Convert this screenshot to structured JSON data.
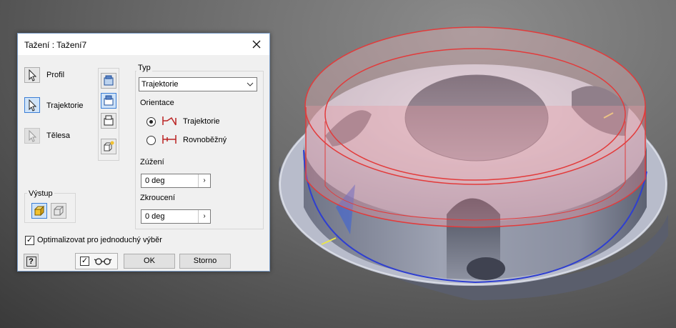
{
  "dialog": {
    "title": "Tažení : Tažení7",
    "selectors": [
      {
        "label": "Profil"
      },
      {
        "label": "Trajektorie"
      },
      {
        "label": "Tělesa"
      }
    ],
    "typ": {
      "legend": "Typ",
      "selected": "Trajektorie"
    },
    "orientace": {
      "legend": "Orientace",
      "options": [
        {
          "label": "Trajektorie",
          "selected": true
        },
        {
          "label": "Rovnoběžný",
          "selected": false
        }
      ]
    },
    "zuzeni": {
      "label": "Zúžení",
      "value": "0 deg"
    },
    "zkrouceni": {
      "label": "Zkroucení",
      "value": "0 deg"
    },
    "vystup": {
      "legend": "Výstup"
    },
    "optimize": {
      "label": "Optimalizovat pro jednoduchý výběr",
      "checked": true
    },
    "buttons": {
      "help": "?",
      "ok": "OK",
      "cancel": "Storno"
    }
  },
  "colors": {
    "accent": "#3c7fd6",
    "sweep_preview": "#e23b3b",
    "sketch_highlight": "#2f3fd0"
  }
}
